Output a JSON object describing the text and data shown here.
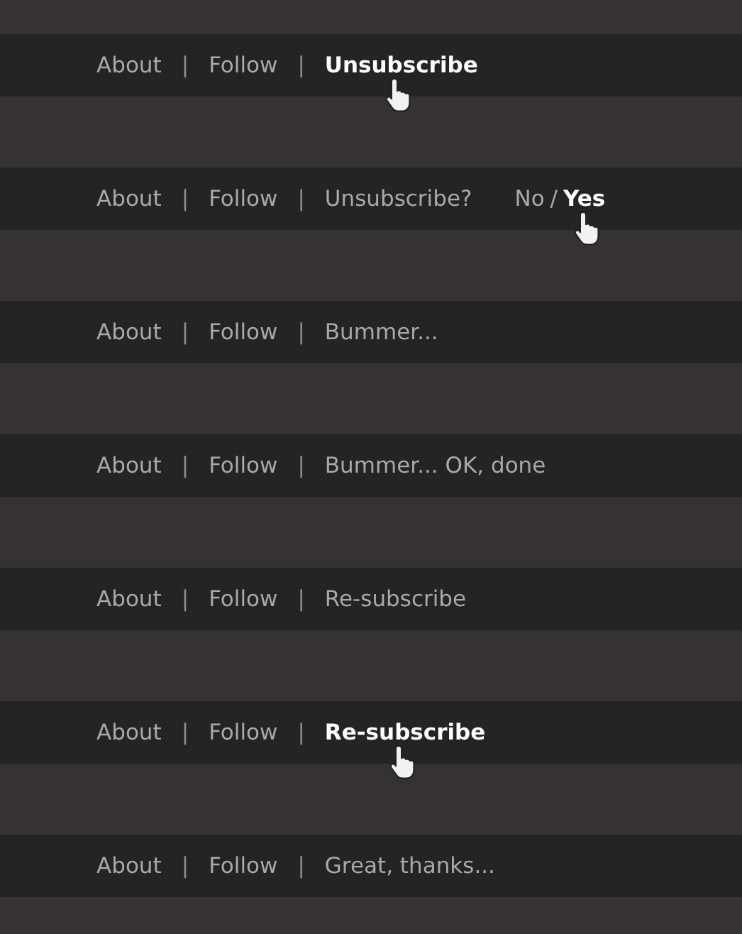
{
  "rows": [
    {
      "items": [
        {
          "kind": "link",
          "label": "About",
          "hovered": false
        },
        {
          "kind": "separator",
          "label": "|"
        },
        {
          "kind": "link",
          "label": "Follow",
          "hovered": false
        },
        {
          "kind": "separator",
          "label": "|"
        },
        {
          "kind": "link",
          "label": "Unsubscribe",
          "hovered": true
        }
      ]
    },
    {
      "items": [
        {
          "kind": "link",
          "label": "About",
          "hovered": false
        },
        {
          "kind": "separator",
          "label": "|"
        },
        {
          "kind": "link",
          "label": "Follow",
          "hovered": false
        },
        {
          "kind": "separator",
          "label": "|"
        },
        {
          "kind": "prompt",
          "label": "Unsubscribe?"
        },
        {
          "kind": "link",
          "label": "No",
          "hovered": false
        },
        {
          "kind": "slash",
          "label": "/"
        },
        {
          "kind": "link",
          "label": "Yes",
          "hovered": true
        }
      ]
    },
    {
      "items": [
        {
          "kind": "link",
          "label": "About",
          "hovered": false
        },
        {
          "kind": "separator",
          "label": "|"
        },
        {
          "kind": "link",
          "label": "Follow",
          "hovered": false
        },
        {
          "kind": "separator",
          "label": "|"
        },
        {
          "kind": "message",
          "label": "Bummer..."
        }
      ]
    },
    {
      "items": [
        {
          "kind": "link",
          "label": "About",
          "hovered": false
        },
        {
          "kind": "separator",
          "label": "|"
        },
        {
          "kind": "link",
          "label": "Follow",
          "hovered": false
        },
        {
          "kind": "separator",
          "label": "|"
        },
        {
          "kind": "message",
          "label": "Bummer... OK, done"
        }
      ]
    },
    {
      "items": [
        {
          "kind": "link",
          "label": "About",
          "hovered": false
        },
        {
          "kind": "separator",
          "label": "|"
        },
        {
          "kind": "link",
          "label": "Follow",
          "hovered": false
        },
        {
          "kind": "separator",
          "label": "|"
        },
        {
          "kind": "link",
          "label": "Re-subscribe",
          "hovered": false
        }
      ]
    },
    {
      "items": [
        {
          "kind": "link",
          "label": "About",
          "hovered": false
        },
        {
          "kind": "separator",
          "label": "|"
        },
        {
          "kind": "link",
          "label": "Follow",
          "hovered": false
        },
        {
          "kind": "separator",
          "label": "|"
        },
        {
          "kind": "link",
          "label": "Re-subscribe",
          "hovered": true
        }
      ]
    },
    {
      "items": [
        {
          "kind": "link",
          "label": "About",
          "hovered": false
        },
        {
          "kind": "separator",
          "label": "|"
        },
        {
          "kind": "link",
          "label": "Follow",
          "hovered": false
        },
        {
          "kind": "separator",
          "label": "|"
        },
        {
          "kind": "message",
          "label": "Great, thanks..."
        }
      ]
    }
  ]
}
